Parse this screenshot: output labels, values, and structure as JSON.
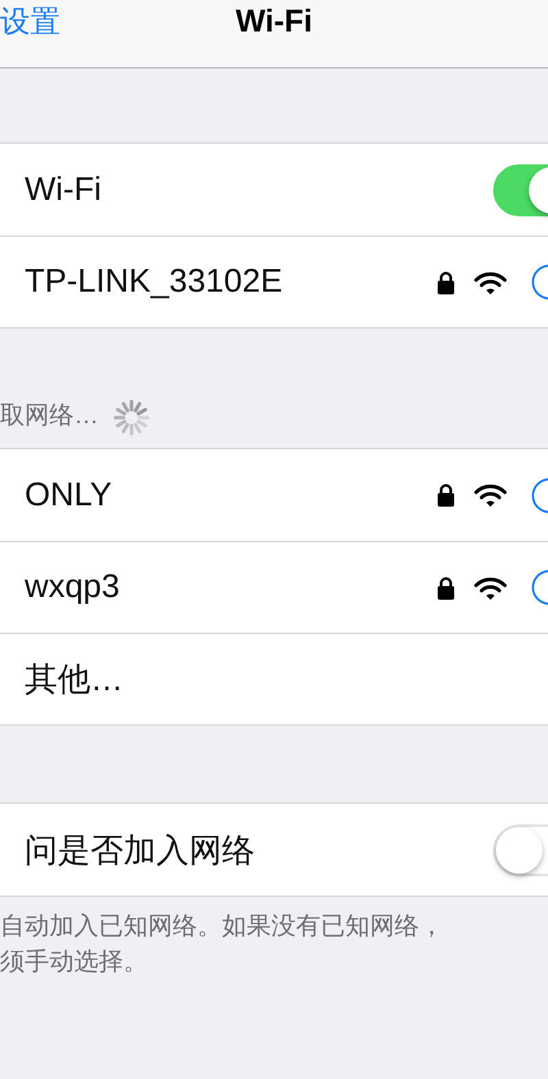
{
  "nav": {
    "back_label": "设置",
    "title": "Wi-Fi"
  },
  "wifi_group": {
    "toggle": {
      "label": "Wi-Fi",
      "on": true
    },
    "current": {
      "name": "TP-LINK_33102E",
      "locked": true
    }
  },
  "networks_header": {
    "label": "取网络…",
    "loading": true
  },
  "networks": [
    {
      "kind": "network",
      "name": "ONLY",
      "locked": true
    },
    {
      "kind": "network",
      "name": "wxqp3",
      "locked": true
    },
    {
      "kind": "other",
      "name": "其他…"
    }
  ],
  "ask_row": {
    "label": "问是否加入网络",
    "on": false
  },
  "footer_lines": [
    "自动加入已知网络。如果没有已知网络，",
    "须手动选择。"
  ]
}
